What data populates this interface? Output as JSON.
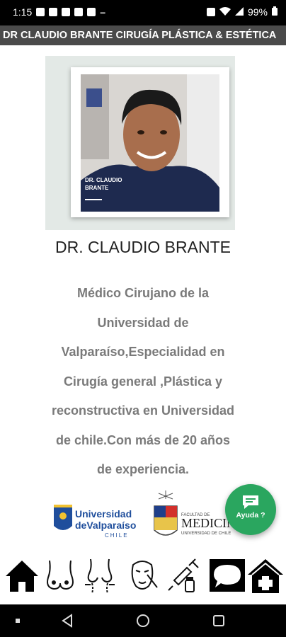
{
  "status": {
    "time": "1:15",
    "battery": "99%"
  },
  "header": {
    "title": "DR CLAUDIO BRANTE CIRUGÍA PLÁSTICA & ESTÉTICA"
  },
  "profile": {
    "photo_caption_line1": "DR. CLAUDIO",
    "photo_caption_line2": "BRANTE",
    "name": "DR. CLAUDIO BRANTE",
    "bio_lines": [
      "Médico Cirujano de la",
      "Universidad de",
      "Valparaíso,Especialidad en",
      "Cirugía general ,Plástica y",
      "reconstructiva en Universidad",
      "de chile.Con más de 20 años",
      "de experiencia."
    ]
  },
  "logos": {
    "uv_line1": "Universidad",
    "uv_line2": "deValparaíso",
    "uv_line3": "CHILE",
    "med_small": "FACULTAD DE",
    "med_big": "MEDICINA",
    "med_sub": "UNIVERSIDAD DE CHILE"
  },
  "help_button": {
    "label": "Ayuda ?"
  },
  "colors": {
    "title_bar": "#4a4a4a",
    "fab": "#2aa65f",
    "uv_blue": "#1f4e9c"
  },
  "bottom_nav": [
    {
      "icon": "home-icon"
    },
    {
      "icon": "breast-icon"
    },
    {
      "icon": "body-contour-icon"
    },
    {
      "icon": "face-icon"
    },
    {
      "icon": "syringe-icon"
    },
    {
      "icon": "chat-icon"
    },
    {
      "icon": "clinic-icon"
    }
  ]
}
